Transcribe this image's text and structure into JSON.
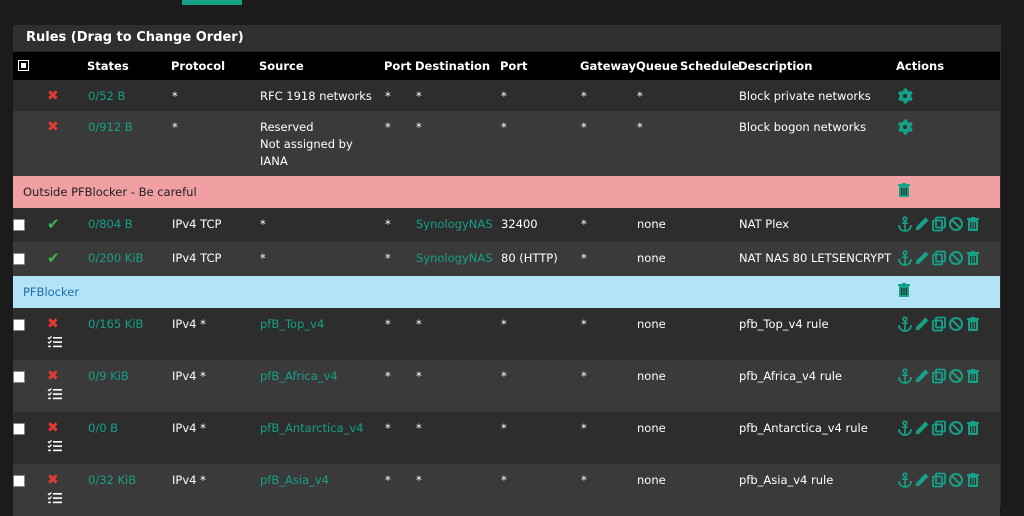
{
  "panel": {
    "title": "Rules (Drag to Change Order)"
  },
  "columns": {
    "states": "States",
    "protocol": "Protocol",
    "source": "Source",
    "port": "Port",
    "destination": "Destination",
    "dest_port": "Port",
    "gateway": "Gateway",
    "queue": "Queue",
    "schedule": "Schedule",
    "description": "Description",
    "actions": "Actions"
  },
  "rules": [
    {
      "states": "0/52 B",
      "protocol": "*",
      "source": "RFC 1918 networks",
      "port": "*",
      "destination": "*",
      "dest_port": "*",
      "gateway": "*",
      "queue": "*",
      "schedule": "",
      "description": "Block private networks"
    },
    {
      "states": "0/912 B",
      "protocol": "*",
      "source": "Reserved\nNot assigned by IANA",
      "port": "*",
      "destination": "*",
      "dest_port": "*",
      "gateway": "*",
      "queue": "*",
      "schedule": "",
      "description": "Block bogon networks"
    },
    {
      "states": "0/804 B",
      "protocol": "IPv4 TCP",
      "source": "*",
      "port": "*",
      "destination": "SynologyNAS",
      "dest_port": "32400",
      "gateway": "*",
      "queue": "none",
      "schedule": "",
      "description": "NAT Plex"
    },
    {
      "states": "0/200 KiB",
      "protocol": "IPv4 TCP",
      "source": "*",
      "port": "*",
      "destination": "SynologyNAS",
      "dest_port": "80 (HTTP)",
      "gateway": "*",
      "queue": "none",
      "schedule": "",
      "description": "NAT NAS 80 LETSENCRYPT"
    },
    {
      "states": "0/165 KiB",
      "protocol": "IPv4 *",
      "source": "pfB_Top_v4",
      "port": "*",
      "destination": "*",
      "dest_port": "*",
      "gateway": "*",
      "queue": "none",
      "schedule": "",
      "description": "pfb_Top_v4 rule"
    },
    {
      "states": "0/9 KiB",
      "protocol": "IPv4 *",
      "source": "pfB_Africa_v4",
      "port": "*",
      "destination": "*",
      "dest_port": "*",
      "gateway": "*",
      "queue": "none",
      "schedule": "",
      "description": "pfb_Africa_v4 rule"
    },
    {
      "states": "0/0 B",
      "protocol": "IPv4 *",
      "source": "pfB_Antarctica_v4",
      "port": "*",
      "destination": "*",
      "dest_port": "*",
      "gateway": "*",
      "queue": "none",
      "schedule": "",
      "description": "pfb_Antarctica_v4 rule"
    },
    {
      "states": "0/32 KiB",
      "protocol": "IPv4 *",
      "source": "pfB_Asia_v4",
      "port": "*",
      "destination": "*",
      "dest_port": "*",
      "gateway": "*",
      "queue": "none",
      "schedule": "",
      "description": "pfb_Asia_v4 rule"
    }
  ],
  "separators": {
    "outside": "Outside PFBlocker - Be careful",
    "pfblocker": "PFBlocker"
  },
  "icons": {
    "settings": "gear-icon",
    "delete": "trash-icon",
    "anchor": "anchor-icon",
    "edit": "pencil-icon",
    "copy": "copy-icon",
    "disable": "ban-icon",
    "block": "x-icon",
    "pass": "check-icon",
    "log": "list-icon"
  },
  "colors": {
    "accent": "#16a085",
    "block": "#e53935",
    "pass": "#3fb34f",
    "separator_red": "#f0a0a2",
    "separator_blue": "#b3e3f7"
  }
}
